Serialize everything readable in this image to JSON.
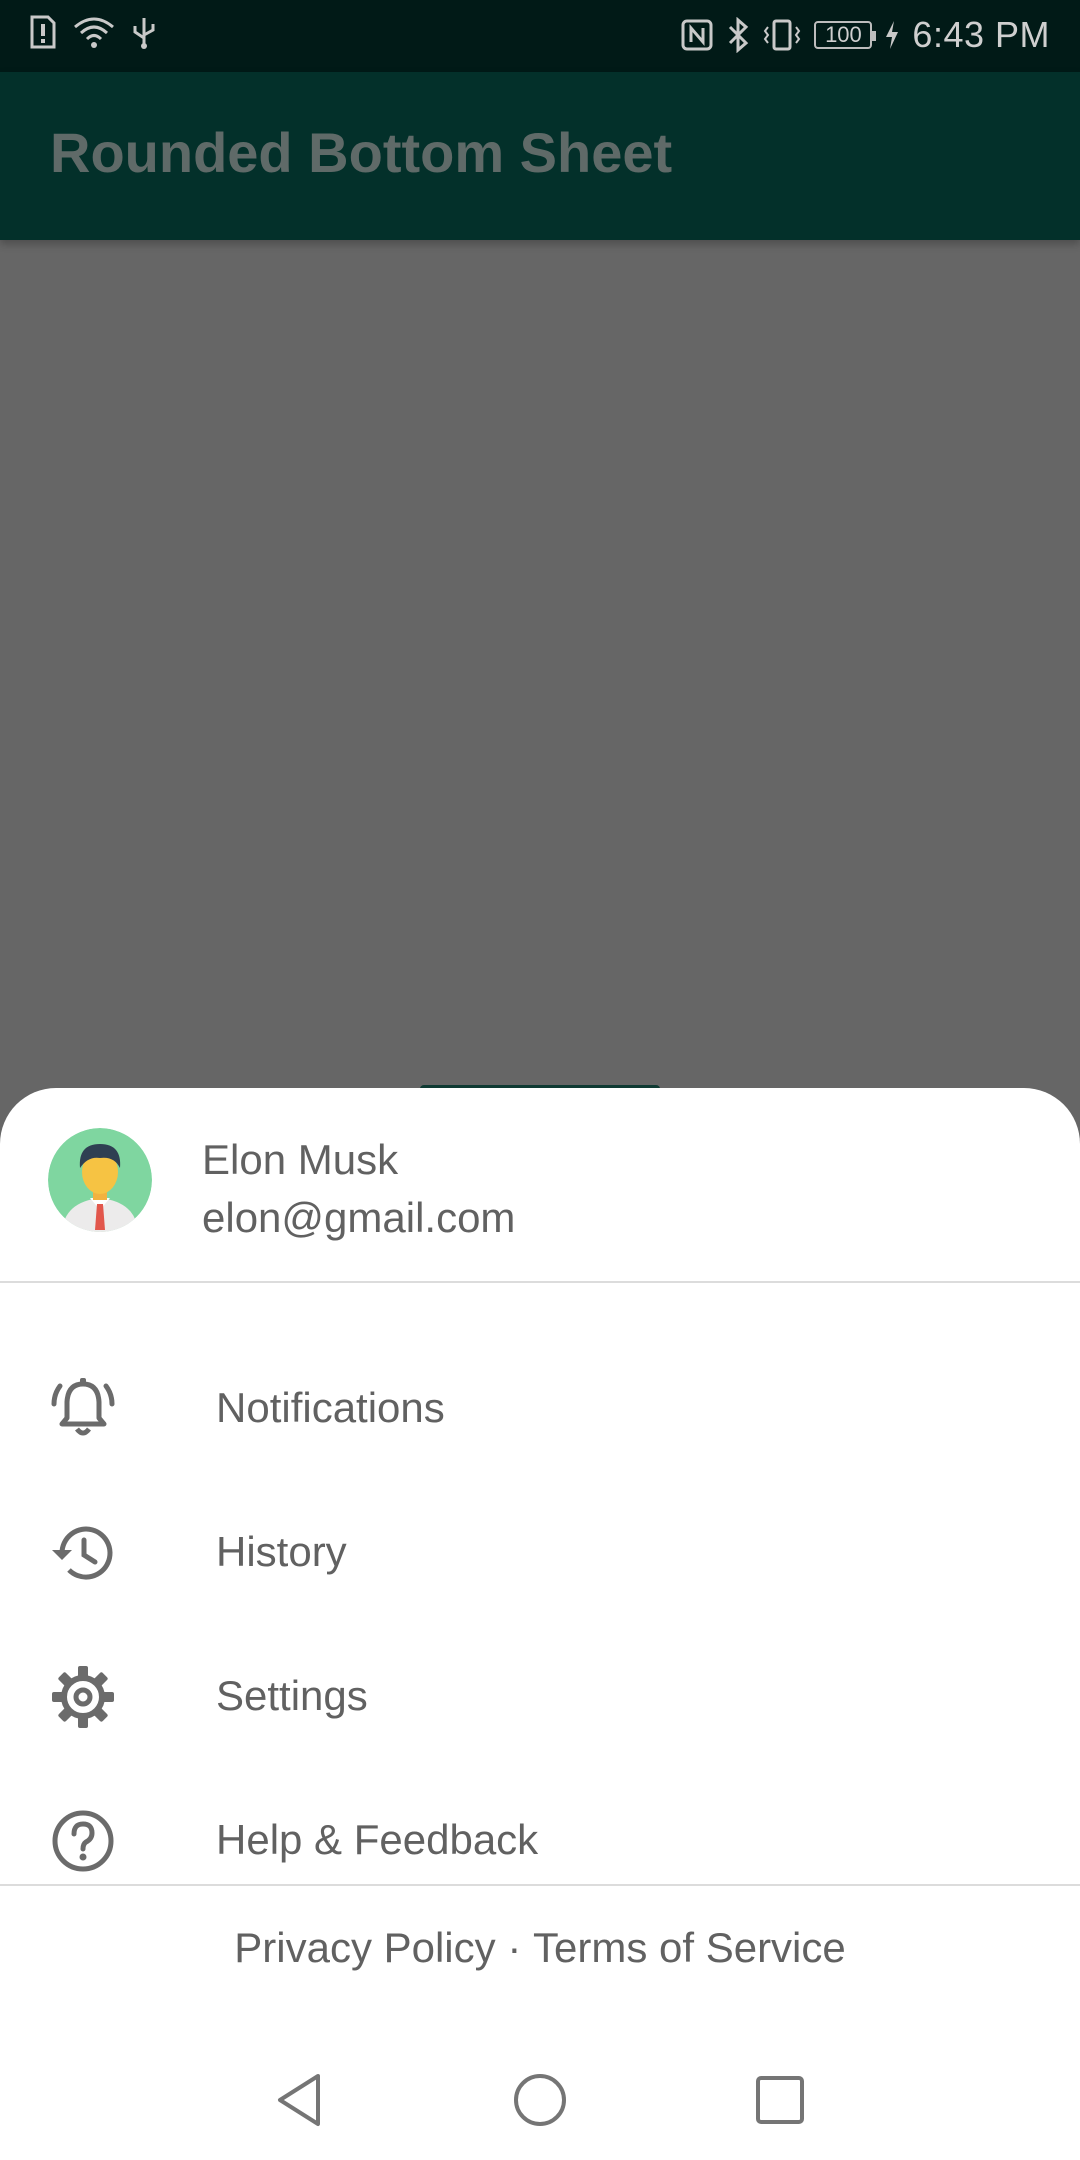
{
  "status_bar": {
    "time": "6:43 PM",
    "battery": "100",
    "icons_left": [
      "sim-alert-icon",
      "wifi-icon",
      "usb-icon"
    ],
    "icons_right": [
      "nfc-icon",
      "bluetooth-icon",
      "vibrate-icon",
      "battery-icon",
      "charging-icon"
    ]
  },
  "app_bar": {
    "title": "Rounded Bottom Sheet"
  },
  "sheet": {
    "profile": {
      "name": "Elon Musk",
      "email": "elon@gmail.com",
      "avatar_icon": "user-avatar-icon"
    },
    "menu": [
      {
        "label": "Notifications",
        "icon": "bell-icon"
      },
      {
        "label": "History",
        "icon": "history-icon"
      },
      {
        "label": "Settings",
        "icon": "gear-icon"
      },
      {
        "label": "Help & Feedback",
        "icon": "help-icon"
      }
    ],
    "footer": {
      "privacy": "Privacy Policy",
      "separator": "·",
      "terms": "Terms of Service"
    }
  },
  "nav_bar": {
    "buttons": [
      "back-icon",
      "home-icon",
      "recents-icon"
    ]
  },
  "colors": {
    "status_bar": "#011a17",
    "app_bar": "#03302a",
    "scrim": "#666666",
    "sheet": "#ffffff",
    "text": "#616161",
    "icon": "#6b6b6b"
  }
}
